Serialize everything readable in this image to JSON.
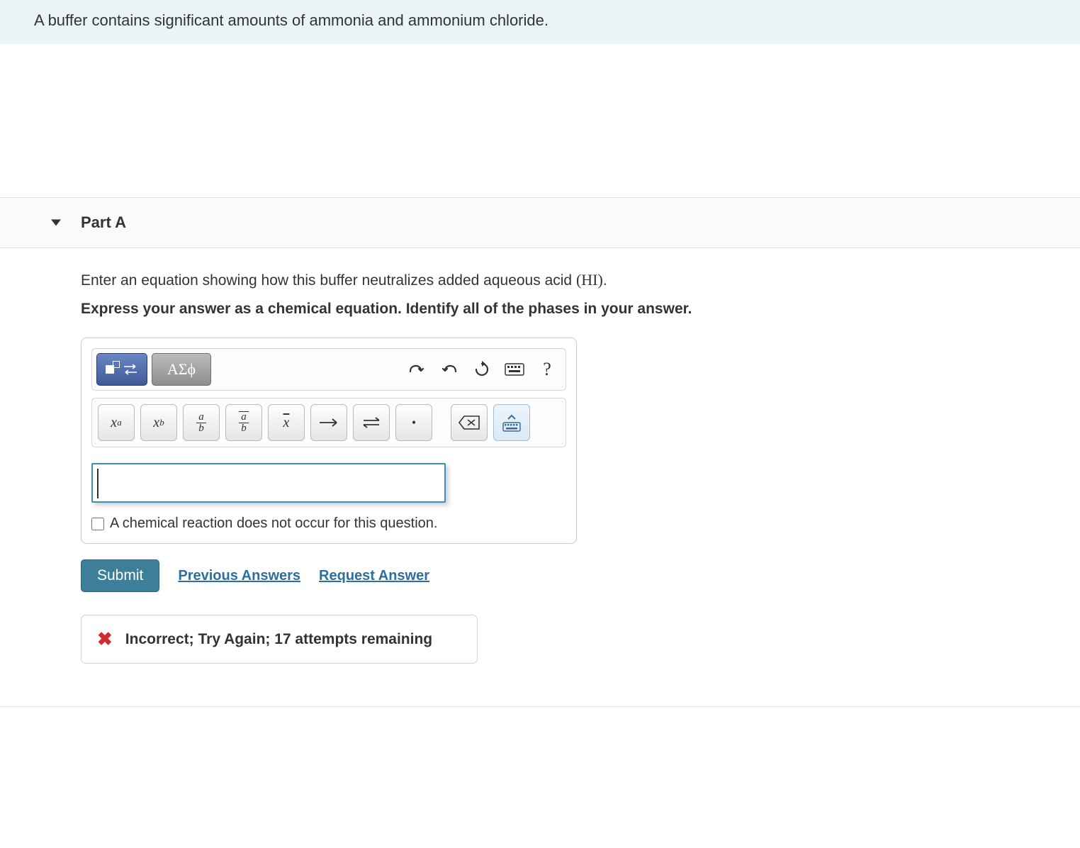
{
  "problem_statement": "A buffer contains significant amounts of ammonia and ammonium chloride.",
  "part": {
    "label": "Part A",
    "prompt_prefix": "Enter an equation showing how this buffer neutralizes added aqueous acid ",
    "prompt_formula": "(HI)",
    "prompt_suffix": ".",
    "instruction": "Express your answer as a chemical equation. Identify all of the phases in your answer."
  },
  "editor": {
    "tabs": {
      "greek": "ΑΣϕ"
    },
    "no_reaction_label": "A chemical reaction does not occur for this question.",
    "help_label": "?"
  },
  "actions": {
    "submit": "Submit",
    "previous": "Previous Answers",
    "request": "Request Answer"
  },
  "feedback": {
    "text": "Incorrect; Try Again; 17 attempts remaining"
  }
}
